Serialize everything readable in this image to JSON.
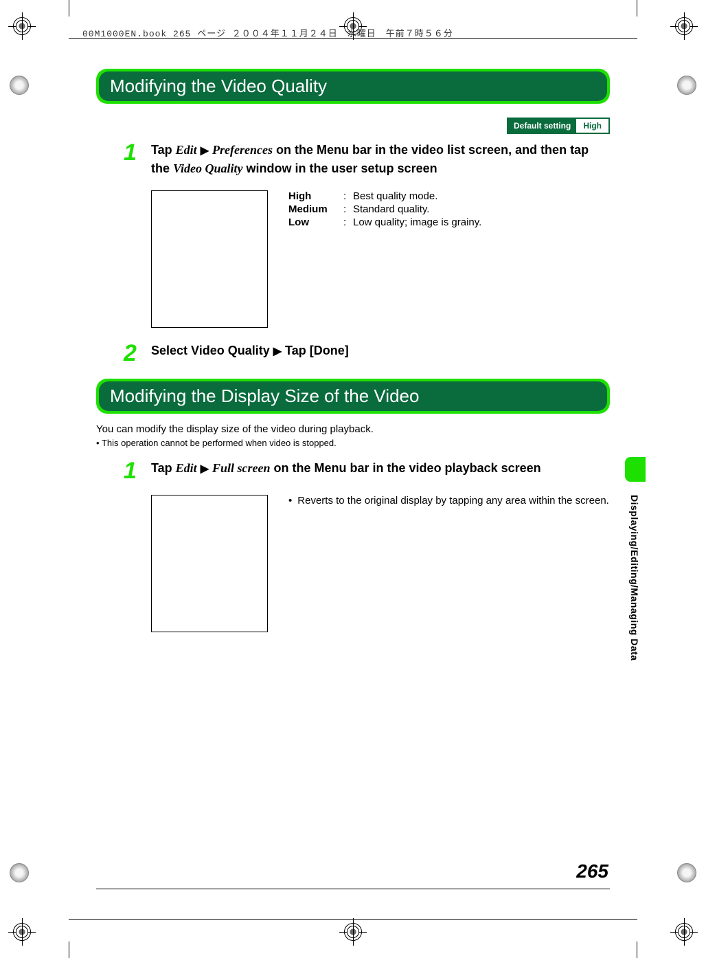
{
  "header_line": "00M1000EN.book  265 ページ  ２００４年１１月２４日　水曜日　午前７時５６分",
  "section1": {
    "title": "Modifying the Video Quality",
    "default_label": "Default setting",
    "default_value": "High",
    "step1_num": "1",
    "step1_p1a": "Tap ",
    "step1_p1b": "Edit",
    "step1_p1c": "Preferences",
    "step1_p1d": " on the Menu bar in the video list screen, and then tap the ",
    "step1_p1e": "Video Quality",
    "step1_p1f": " window in the user setup screen",
    "defs": [
      {
        "term": "High",
        "desc": "Best quality mode."
      },
      {
        "term": "Medium",
        "desc": "Standard quality."
      },
      {
        "term": "Low",
        "desc": "Low quality; image is grainy."
      }
    ],
    "step2_num": "2",
    "step2_text_a": "Select Video Quality ",
    "step2_text_b": " Tap [Done]"
  },
  "section2": {
    "title": "Modifying the Display Size of the Video",
    "intro": "You can modify the display size of the video during playback.",
    "note": "This operation cannot be performed when video is stopped.",
    "step1_num": "1",
    "step1_a": "Tap ",
    "step1_b": "Edit",
    "step1_c": "Full screen",
    "step1_d": " on the Menu bar in the video playback screen",
    "bullet": "Reverts to the original display by tapping any area within the screen."
  },
  "side_label": "Displaying/Editing/Managing Data",
  "page_number": "265",
  "arrow": "▶"
}
